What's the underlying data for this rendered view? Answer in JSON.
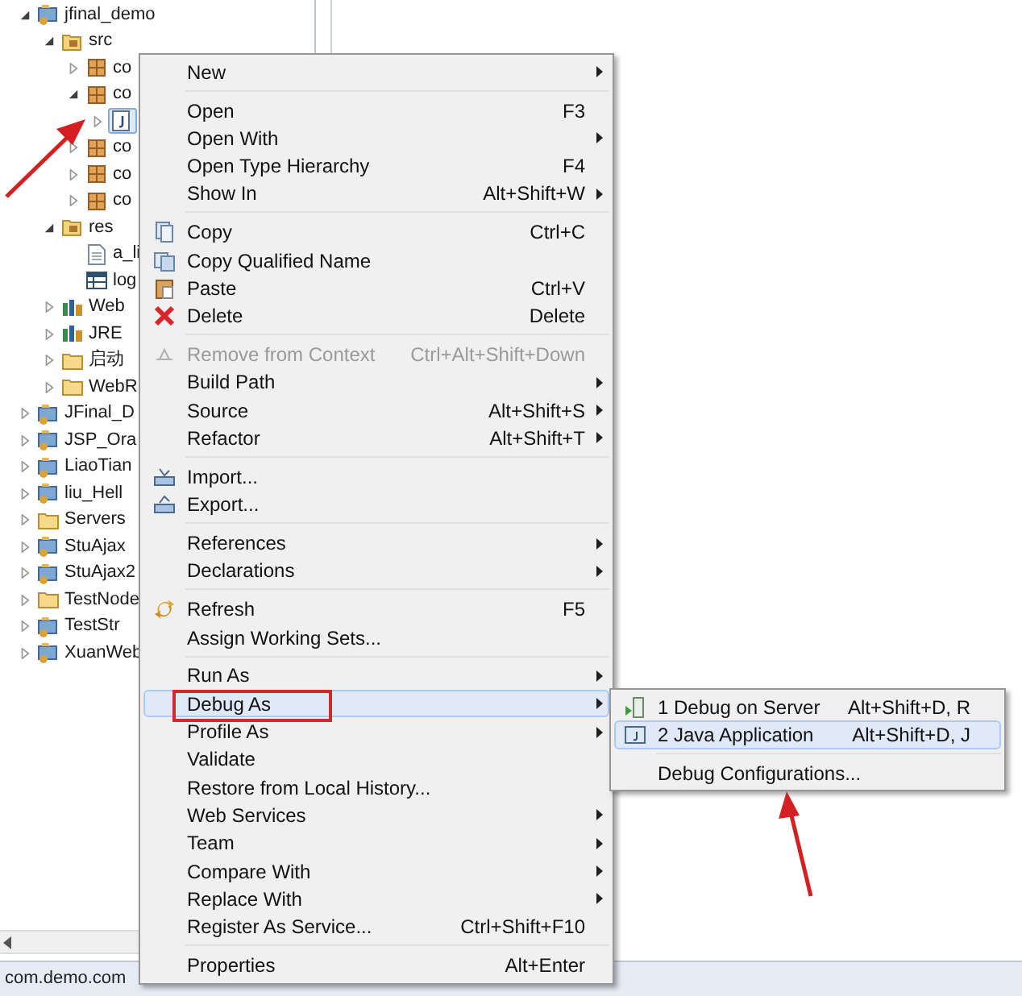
{
  "tree": [
    {
      "label": "jfinal_demo",
      "kind": "project",
      "expanded": true,
      "selected": false,
      "children": [
        {
          "label": "src",
          "kind": "source-folder",
          "expanded": true,
          "selected": false,
          "children": [
            {
              "label": "co",
              "kind": "package",
              "expanded": false,
              "selected": false
            },
            {
              "label": "co",
              "kind": "package",
              "expanded": true,
              "selected": false,
              "children": [
                {
                  "kind": "java-file",
                  "expanded": false,
                  "selected": true
                }
              ]
            },
            {
              "label": "co",
              "kind": "package",
              "expanded": false,
              "selected": false
            },
            {
              "label": "co",
              "kind": "package",
              "expanded": false,
              "selected": false
            },
            {
              "label": "co",
              "kind": "package",
              "expanded": false,
              "selected": false
            }
          ]
        },
        {
          "label": "res",
          "kind": "source-folder",
          "expanded": true,
          "selected": false,
          "children": [
            {
              "label": "a_li",
              "kind": "text-file",
              "selected": false
            },
            {
              "label": "log",
              "kind": "properties-file",
              "selected": false
            }
          ]
        },
        {
          "label": "Web",
          "kind": "library",
          "expanded": false,
          "selected": false
        },
        {
          "label": "JRE",
          "kind": "library",
          "expanded": false,
          "selected": false
        },
        {
          "label": "启动",
          "kind": "folder",
          "expanded": false,
          "selected": false
        },
        {
          "label": "WebR",
          "kind": "folder",
          "expanded": false,
          "selected": false
        }
      ]
    },
    {
      "label": "JFinal_D",
      "kind": "project",
      "expanded": false,
      "selected": false
    },
    {
      "label": "JSP_Ora",
      "kind": "project",
      "expanded": false,
      "selected": false
    },
    {
      "label": "LiaoTian",
      "kind": "project",
      "expanded": false,
      "selected": false
    },
    {
      "label": "liu_Hell",
      "kind": "project",
      "expanded": false,
      "selected": false
    },
    {
      "label": "Servers",
      "kind": "folder",
      "expanded": false,
      "selected": false
    },
    {
      "label": "StuAjax",
      "kind": "project",
      "expanded": false,
      "selected": false
    },
    {
      "label": "StuAjax2",
      "kind": "project",
      "expanded": false,
      "selected": false
    },
    {
      "label": "TestNode",
      "kind": "folder",
      "expanded": false,
      "selected": false
    },
    {
      "label": "TestStr",
      "kind": "project",
      "expanded": false,
      "selected": false
    },
    {
      "label": "XuanWeb",
      "kind": "project",
      "expanded": false,
      "selected": false
    }
  ],
  "status_bar": "com.demo.com",
  "context_menu": [
    {
      "kind": "item",
      "label": "New",
      "submenu": true,
      "disabled": false,
      "selected": false
    },
    {
      "kind": "separator"
    },
    {
      "kind": "item",
      "label": "Open",
      "shortcut": "F3",
      "submenu": false,
      "disabled": false,
      "selected": false
    },
    {
      "kind": "item",
      "label": "Open With",
      "submenu": true,
      "disabled": false,
      "selected": false
    },
    {
      "kind": "item",
      "label": "Open Type Hierarchy",
      "shortcut": "F4",
      "submenu": false,
      "disabled": false,
      "selected": false
    },
    {
      "kind": "item",
      "label": "Show In",
      "shortcut": "Alt+Shift+W",
      "submenu": true,
      "disabled": false,
      "selected": false
    },
    {
      "kind": "separator"
    },
    {
      "kind": "copy",
      "label": "Copy",
      "shortcut": "Ctrl+C",
      "submenu": false,
      "disabled": false,
      "selected": false
    },
    {
      "kind": "copy-name",
      "label": "Copy Qualified Name",
      "submenu": false,
      "disabled": false,
      "selected": false
    },
    {
      "kind": "paste",
      "label": "Paste",
      "shortcut": "Ctrl+V",
      "submenu": false,
      "disabled": false,
      "selected": false
    },
    {
      "kind": "delete",
      "label": "Delete",
      "shortcut": "Delete",
      "submenu": false,
      "disabled": false,
      "selected": false
    },
    {
      "kind": "separator"
    },
    {
      "kind": "remove",
      "label": "Remove from Context",
      "shortcut": "Ctrl+Alt+Shift+Down",
      "submenu": false,
      "disabled": true,
      "selected": false
    },
    {
      "kind": "item",
      "label": "Build Path",
      "submenu": true,
      "disabled": false,
      "selected": false
    },
    {
      "kind": "item",
      "label": "Source",
      "shortcut": "Alt+Shift+S",
      "submenu": true,
      "disabled": false,
      "selected": false
    },
    {
      "kind": "item",
      "label": "Refactor",
      "shortcut": "Alt+Shift+T",
      "submenu": true,
      "disabled": false,
      "selected": false
    },
    {
      "kind": "separator"
    },
    {
      "kind": "import",
      "label": "Import...",
      "submenu": false,
      "disabled": false,
      "selected": false
    },
    {
      "kind": "export",
      "label": "Export...",
      "submenu": false,
      "disabled": false,
      "selected": false
    },
    {
      "kind": "separator"
    },
    {
      "kind": "item",
      "label": "References",
      "submenu": true,
      "disabled": false,
      "selected": false
    },
    {
      "kind": "item",
      "label": "Declarations",
      "submenu": true,
      "disabled": false,
      "selected": false
    },
    {
      "kind": "separator"
    },
    {
      "kind": "refresh",
      "label": "Refresh",
      "shortcut": "F5",
      "submenu": false,
      "disabled": false,
      "selected": false
    },
    {
      "kind": "item",
      "label": "Assign Working Sets...",
      "submenu": false,
      "disabled": false,
      "selected": false
    },
    {
      "kind": "separator"
    },
    {
      "kind": "item",
      "label": "Run As",
      "submenu": true,
      "disabled": false,
      "selected": false
    },
    {
      "kind": "item",
      "label": "Debug As",
      "submenu": true,
      "disabled": false,
      "selected": true
    },
    {
      "kind": "item",
      "label": "Profile As",
      "submenu": true,
      "disabled": false,
      "selected": false
    },
    {
      "kind": "item",
      "label": "Validate",
      "submenu": false,
      "disabled": false,
      "selected": false
    },
    {
      "kind": "item",
      "label": "Restore from Local History...",
      "submenu": false,
      "disabled": false,
      "selected": false
    },
    {
      "kind": "item",
      "label": "Web Services",
      "submenu": true,
      "disabled": false,
      "selected": false
    },
    {
      "kind": "item",
      "label": "Team",
      "submenu": true,
      "disabled": false,
      "selected": false
    },
    {
      "kind": "item",
      "label": "Compare With",
      "submenu": true,
      "disabled": false,
      "selected": false
    },
    {
      "kind": "item",
      "label": "Replace With",
      "submenu": true,
      "disabled": false,
      "selected": false
    },
    {
      "kind": "item",
      "label": "Register As Service...",
      "shortcut": "Ctrl+Shift+F10",
      "submenu": false,
      "disabled": false,
      "selected": false
    },
    {
      "kind": "separator"
    },
    {
      "kind": "item",
      "label": "Properties",
      "shortcut": "Alt+Enter",
      "submenu": false,
      "disabled": false,
      "selected": false
    }
  ],
  "submenu": [
    {
      "kind": "server-debug",
      "label": "1 Debug on Server",
      "shortcut": "Alt+Shift+D, R",
      "selected": false
    },
    {
      "kind": "java-app",
      "label": "2 Java Application",
      "shortcut": "Alt+Shift+D, J",
      "selected": true
    },
    {
      "kind": "separator"
    },
    {
      "kind": "item",
      "label": "Debug Configurations...",
      "selected": false
    }
  ]
}
